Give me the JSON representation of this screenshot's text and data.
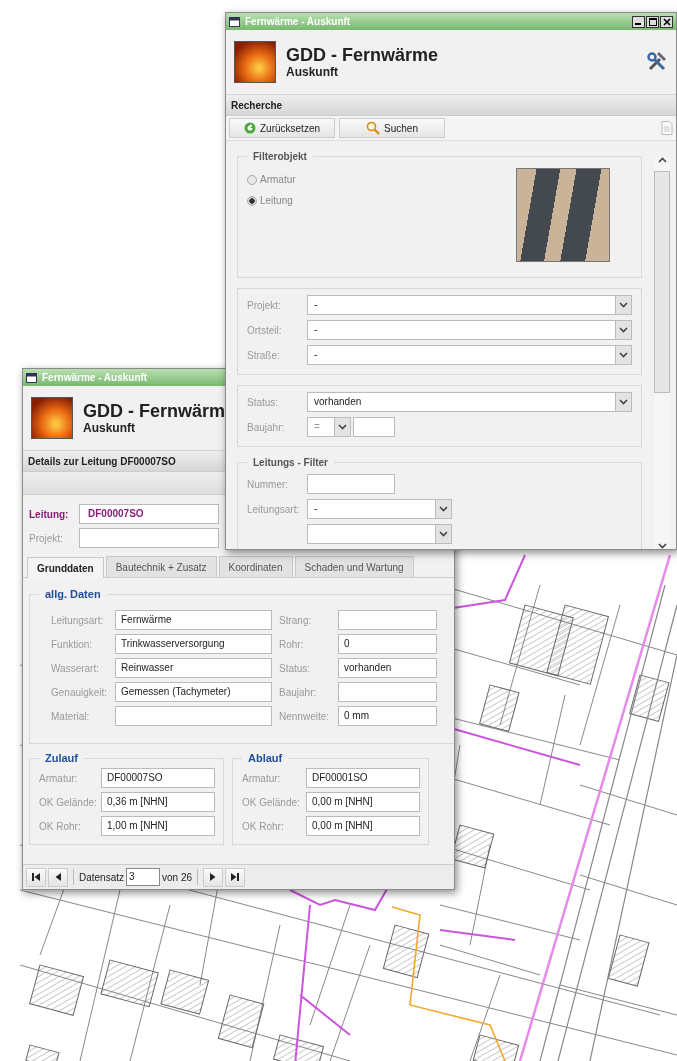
{
  "search_window": {
    "title": "Fernwärme - Auskunft",
    "app_title": "GDD - Fernwärme",
    "app_subtitle": "Auskunft",
    "section": "Recherche",
    "toolbar": [
      {
        "label": "Zurücksetzen",
        "kind": "reset"
      },
      {
        "label": "Suchen",
        "kind": "search"
      }
    ],
    "filter_object": {
      "legend": "Filterobjekt",
      "options": [
        {
          "label": "Armatur",
          "selected": false
        },
        {
          "label": "Leitung",
          "selected": true
        }
      ]
    },
    "location_fields": [
      {
        "label": "Projekt:",
        "value": "-"
      },
      {
        "label": "Ortsteil:",
        "value": "-"
      },
      {
        "label": "Straße:",
        "value": "-"
      }
    ],
    "status": {
      "label": "Status:",
      "value": "vorhanden"
    },
    "baujahr": {
      "label": "Baujahr:",
      "operator": "="
    },
    "line_filter": {
      "legend": "Leitungs - Filter",
      "fields": [
        {
          "label": "Nummer:",
          "kind": "text"
        },
        {
          "label": "Leitungsart:",
          "kind": "combo",
          "value": "-"
        },
        {
          "kind": "combo"
        }
      ]
    }
  },
  "detail_window": {
    "title": "Fernwärme - Auskunft",
    "app_title": "GDD - Fernwärm",
    "app_subtitle": "Auskunft",
    "heading": "Details zur Leitung DF00007SO",
    "key_fields": [
      {
        "label": "Leitung:",
        "value": "DF00007SO",
        "kind": "highlight"
      },
      {
        "label": "Projekt:",
        "kind": "plain"
      }
    ],
    "tabs": [
      {
        "label": "Grunddaten",
        "selected": true
      },
      {
        "label": "Bautechnik + Zusatz",
        "selected": false
      },
      {
        "label": "Koordinaten",
        "selected": false
      },
      {
        "label": "Schaden und Wartung",
        "selected": false
      }
    ],
    "general": {
      "legend": "allg. Daten",
      "left": [
        {
          "label": "Leitungsart:",
          "value": "Fernwärme"
        },
        {
          "label": "Funktion:",
          "value": "Trinkwasserversorgung"
        },
        {
          "label": "Wasserart:",
          "value": "Reinwasser"
        },
        {
          "label": "Genauigkeit:",
          "value": "Gemessen (Tachymeter)"
        },
        {
          "label": "Material:"
        }
      ],
      "right": [
        {
          "label": "Strang:"
        },
        {
          "label": "Rohr:",
          "value": "0"
        },
        {
          "label": "Status:",
          "value": "vorhanden"
        },
        {
          "label": "Baujahr:"
        },
        {
          "label": "Nennweite:",
          "value": "0 mm"
        }
      ]
    },
    "inflow": {
      "legend": "Zulauf",
      "fields": [
        {
          "label": "Armatur:",
          "value": "DF00007SO"
        },
        {
          "label": "OK Gelände:",
          "value": "0,36 m [NHN]"
        },
        {
          "label": "OK Rohr:",
          "value": "1,00 m [NHN]"
        }
      ]
    },
    "outflow": {
      "legend": "Ablauf",
      "fields": [
        {
          "label": "Armatur:",
          "value": "DF00001SO"
        },
        {
          "label": "OK Gelände:",
          "value": "0,00 m [NHN]"
        },
        {
          "label": "OK Rohr:",
          "value": "0,00 m [NHN]"
        }
      ]
    },
    "pager": {
      "label": "Datensatz",
      "value": "3",
      "total": "von 26"
    }
  }
}
